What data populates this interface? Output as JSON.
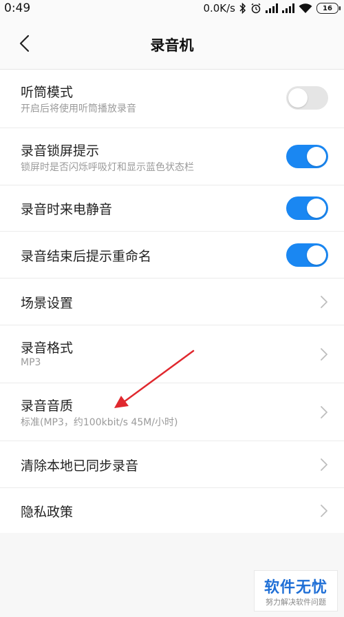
{
  "status_bar": {
    "time": "0:49",
    "network_speed": "0.0K/s",
    "battery": "16",
    "icons": [
      "bluetooth-icon",
      "alarm-icon",
      "signal-icon",
      "signal-icon",
      "wifi-icon",
      "battery-icon"
    ]
  },
  "header": {
    "title": "录音机",
    "back_icon": "chevron-left-icon"
  },
  "settings": [
    {
      "title": "听筒模式",
      "subtitle": "开启后将使用听筒播放录音",
      "control": "toggle",
      "on": false
    },
    {
      "title": "录音锁屏提示",
      "subtitle": "锁屏时是否闪烁呼吸灯和显示蓝色状态栏",
      "control": "toggle",
      "on": true
    },
    {
      "title": "录音时来电静音",
      "control": "toggle",
      "on": true
    },
    {
      "title": "录音结束后提示重命名",
      "control": "toggle",
      "on": true
    },
    {
      "title": "场景设置",
      "control": "chevron"
    },
    {
      "title": "录音格式",
      "subtitle": "MP3",
      "control": "chevron"
    },
    {
      "title": "录音音质",
      "subtitle": "标准(MP3，约100kbit/s 45M/小时)",
      "control": "chevron"
    },
    {
      "title": "清除本地已同步录音",
      "control": "chevron"
    },
    {
      "title": "隐私政策",
      "control": "chevron"
    }
  ],
  "colors": {
    "toggle_on": "#1a87f2",
    "toggle_off": "#e5e5e5",
    "annotation_arrow": "#e0282e",
    "watermark_text": "#1f6fd6"
  },
  "watermark": {
    "main": "软件无忧",
    "sub": "努力解决软件问题"
  }
}
